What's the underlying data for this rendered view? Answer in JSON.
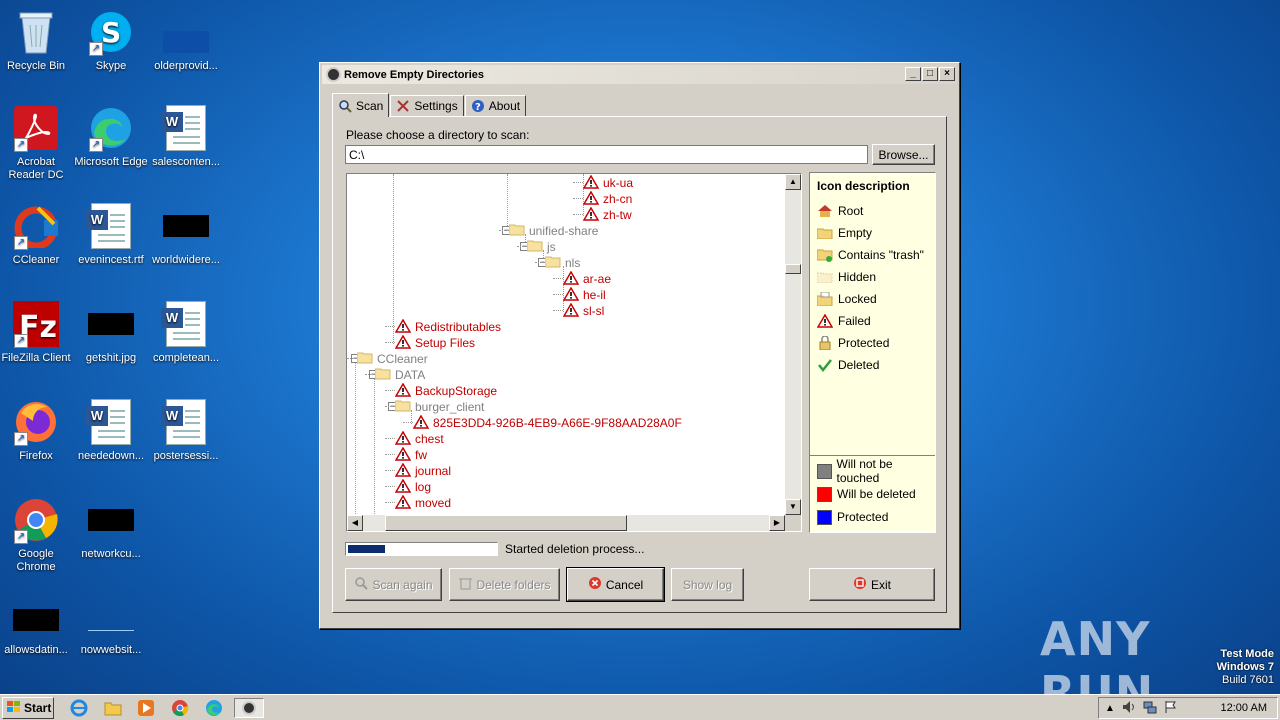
{
  "desktop": {
    "icons": [
      {
        "label": "Recycle Bin",
        "icon": "recycle-bin-icon"
      },
      {
        "label": "Skype",
        "icon": "skype-icon"
      },
      {
        "label": "olderprovid...",
        "icon": "file-icon"
      },
      {
        "label": "Acrobat Reader DC",
        "icon": "acrobat-icon"
      },
      {
        "label": "Microsoft Edge",
        "icon": "edge-icon"
      },
      {
        "label": "salesconten...",
        "icon": "word-doc-icon"
      },
      {
        "label": "CCleaner",
        "icon": "ccleaner-icon"
      },
      {
        "label": "evenincest.rtf",
        "icon": "word-doc-icon"
      },
      {
        "label": "worldwidere...",
        "icon": "black-thumb-icon"
      },
      {
        "label": "FileZilla Client",
        "icon": "filezilla-icon"
      },
      {
        "label": "getshit.jpg",
        "icon": "black-thumb-icon"
      },
      {
        "label": "completean...",
        "icon": "word-doc-icon"
      },
      {
        "label": "Firefox",
        "icon": "firefox-icon"
      },
      {
        "label": "neededown...",
        "icon": "word-doc-icon"
      },
      {
        "label": "postersessi...",
        "icon": "word-doc-icon"
      },
      {
        "label": "Google Chrome",
        "icon": "chrome-icon"
      },
      {
        "label": "networkcu...",
        "icon": "black-thumb-icon"
      },
      {
        "label": "allowsdatin...",
        "icon": "black-thumb-icon"
      },
      {
        "label": "nowwebsit...",
        "icon": "file-icon"
      }
    ]
  },
  "window": {
    "title": "Remove Empty Directories",
    "tabs": [
      {
        "label": "Scan",
        "icon": "magnifier-icon"
      },
      {
        "label": "Settings",
        "icon": "tools-icon"
      },
      {
        "label": "About",
        "icon": "help-icon"
      }
    ],
    "choose_label": "Please choose a directory to scan:",
    "path_value": "C:\\",
    "browse_label": "Browse...",
    "tree": {
      "nodes": [
        {
          "label": "uk-ua",
          "state": "failed"
        },
        {
          "label": "zh-cn",
          "state": "failed"
        },
        {
          "label": "zh-tw",
          "state": "failed"
        },
        {
          "label": "unified-share",
          "state": "gray"
        },
        {
          "label": "js",
          "state": "gray"
        },
        {
          "label": "nls",
          "state": "gray"
        },
        {
          "label": "ar-ae",
          "state": "failed"
        },
        {
          "label": "he-il",
          "state": "failed"
        },
        {
          "label": "sl-sl",
          "state": "failed"
        },
        {
          "label": "Redistributables",
          "state": "failed"
        },
        {
          "label": "Setup Files",
          "state": "failed"
        },
        {
          "label": "CCleaner",
          "state": "gray"
        },
        {
          "label": "DATA",
          "state": "gray"
        },
        {
          "label": "BackupStorage",
          "state": "failed"
        },
        {
          "label": "burger_client",
          "state": "gray"
        },
        {
          "label": "825E3DD4-926B-4EB9-A66E-9F88AAD28A0F",
          "state": "failed"
        },
        {
          "label": "chest",
          "state": "failed"
        },
        {
          "label": "fw",
          "state": "failed"
        },
        {
          "label": "journal",
          "state": "failed"
        },
        {
          "label": "log",
          "state": "failed"
        },
        {
          "label": "moved",
          "state": "failed"
        }
      ]
    },
    "legend": {
      "title": "Icon description",
      "items": [
        {
          "label": "Root",
          "icon": "home-icon"
        },
        {
          "label": "Empty",
          "icon": "folder-icon"
        },
        {
          "label": "Contains \"trash\"",
          "icon": "folder-trash-icon"
        },
        {
          "label": "Hidden",
          "icon": "hidden-folder-icon"
        },
        {
          "label": "Locked",
          "icon": "locked-folder-icon"
        },
        {
          "label": "Failed",
          "icon": "warning-icon"
        },
        {
          "label": "Protected",
          "icon": "lock-icon"
        },
        {
          "label": "Deleted",
          "icon": "check-icon"
        }
      ],
      "colors": [
        {
          "label": "Will not be touched",
          "color": "#808080"
        },
        {
          "label": "Will be deleted",
          "color": "#ff0000"
        },
        {
          "label": "Protected",
          "color": "#0000ff"
        }
      ]
    },
    "progress": 0.25,
    "status": "Started deletion process...",
    "buttons": {
      "scan_again": "Scan again",
      "delete_folders": "Delete folders",
      "cancel": "Cancel",
      "show_log": "Show log",
      "exit": "Exit"
    }
  },
  "taskbar": {
    "start_label": "Start",
    "clock": "12:00 AM"
  },
  "watermark": {
    "line1": "Test Mode",
    "line2": "Windows 7",
    "line3": "Build 7601",
    "brand": "ANY RUN"
  }
}
